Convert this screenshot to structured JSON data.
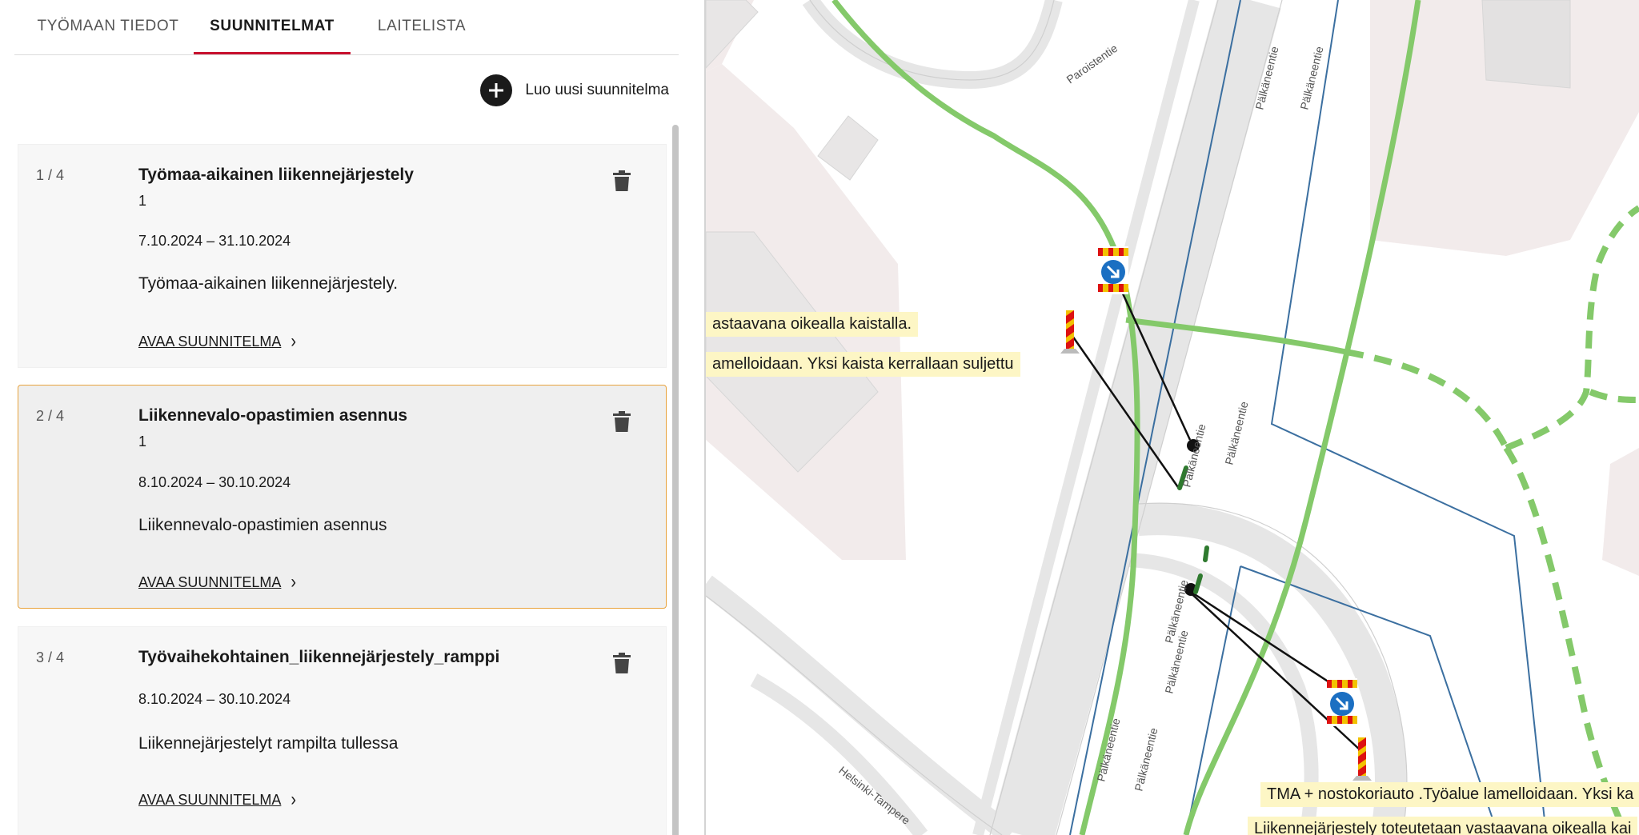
{
  "tabs": [
    {
      "label": "TYÖMAAN TIEDOT"
    },
    {
      "label": "SUUNNITELMAT"
    },
    {
      "label": "LAITELISTA"
    }
  ],
  "new_plan_label": "Luo uusi suunnitelma",
  "plans": [
    {
      "index": "1 / 4",
      "title": "Työmaa-aikainen liikennejärjestely",
      "sub": "1",
      "dates": "7.10.2024 – 31.10.2024",
      "description": "Työmaa-aikainen liikennejärjestely.",
      "open_label": "AVAA SUUNNITELMA"
    },
    {
      "index": "2 / 4",
      "title": "Liikennevalo-opastimien asennus",
      "sub": "1",
      "dates": "8.10.2024 – 30.10.2024",
      "description": "Liikennevalo-opastimien asennus",
      "open_label": "AVAA SUUNNITELMA"
    },
    {
      "index": "3 / 4",
      "title": "Työvaihekohtainen_liikennejärjestely_ramppi",
      "sub": "",
      "dates": "8.10.2024 – 30.10.2024",
      "description": "Liikennejärjestelyt rampilta tullessa",
      "open_label": "AVAA SUUNNITELMA"
    }
  ],
  "map": {
    "street_labels": {
      "paroistentie": "Paroistentie",
      "palkaneentie": "Pälkäneentie",
      "helsinki_tampere": "Helsinki-Tampere"
    },
    "callouts": [
      "astaavana oikealla kaistalla.",
      "amelloidaan. Yksi kaista kerrallaan suljettu",
      "TMA + nostokoriauto .Työalue lamelloidaan. Yksi ka",
      "Liikennejärjestely toteutetaan vastaavana oikealla kai"
    ]
  },
  "colors": {
    "accent": "#c8102e",
    "selected_border": "#e8a33d",
    "route_green": "#84c96a",
    "boundary_blue": "#3b6fa0",
    "callout_bg": "#fdf6c5"
  },
  "icons": [
    "add-icon",
    "trash-icon",
    "chevron-right-icon",
    "keep-right-sign-icon",
    "barrier-post-icon"
  ]
}
